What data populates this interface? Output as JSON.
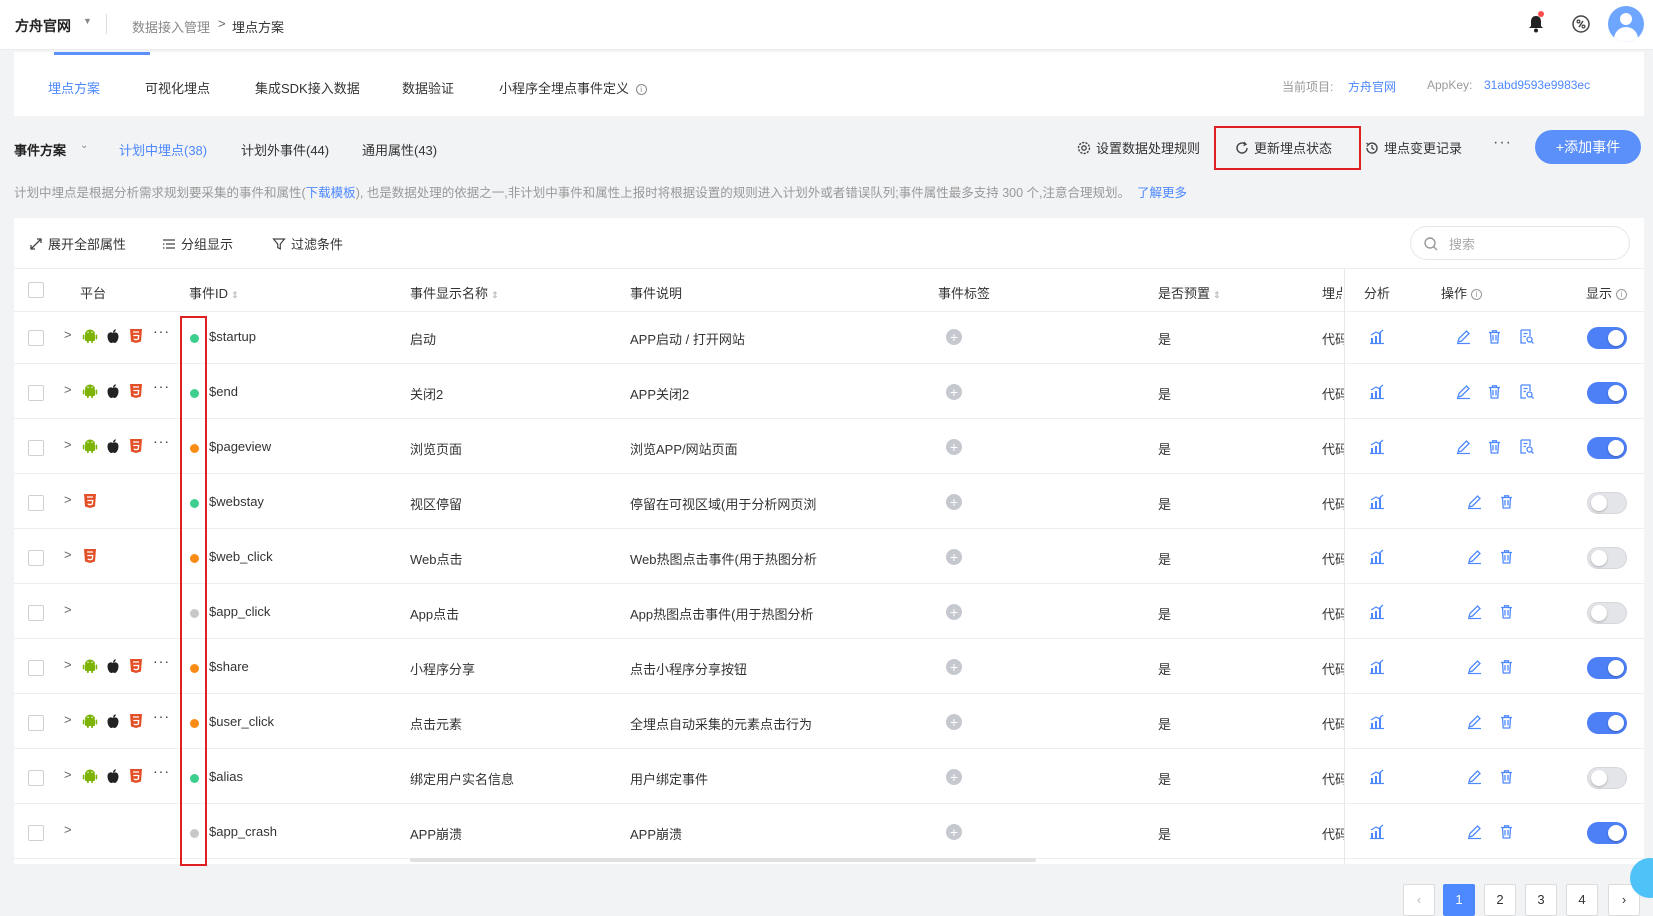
{
  "header": {
    "app_name": "方舟官网",
    "breadcrumb": [
      "数据接入管理",
      "埋点方案"
    ]
  },
  "subnav": {
    "tabs": [
      "埋点方案",
      "可视化埋点",
      "集成SDK接入数据",
      "数据验证",
      "小程序全埋点事件定义"
    ],
    "active": "埋点方案",
    "project_label": "当前项目:",
    "project_value": "方舟官网",
    "appkey_label": "AppKey:",
    "appkey_value": "31abd9593e9983ec"
  },
  "toolbar": {
    "scheme_label": "事件方案",
    "tabs": [
      "计划中埋点(38)",
      "计划外事件(44)",
      "通用属性(43)"
    ],
    "active_tab": "计划中埋点(38)",
    "actions": [
      "设置数据处理规则",
      "更新埋点状态",
      "埋点变更记录"
    ],
    "more": "···",
    "add_label": "+添加事件"
  },
  "notice": {
    "text_1": "计划中埋点是根据分析需求规划要采集的事件和属性(",
    "link_1": "下载模板",
    "text_2": "), 也是数据处理的依据之一,非计划中事件和属性上报时将根据设置的规则进入计划外或者错误队列;事件属性最多支持 300 个,注意合理规划。",
    "link_2": "了解更多"
  },
  "table_tools": {
    "expand_all": "展开全部属性",
    "group_show": "分组显示",
    "filter": "过滤条件",
    "search_placeholder": "搜索"
  },
  "columns": [
    "平台",
    "事件ID",
    "事件显示名称",
    "事件说明",
    "事件标签",
    "是否预置",
    "埋点",
    "分析",
    "操作",
    "显示"
  ],
  "rows": [
    {
      "platforms": [
        "android",
        "apple",
        "html5",
        "more"
      ],
      "status": "green",
      "id": "$startup",
      "name": "启动",
      "desc": "APP启动 / 打开网站",
      "preset": "是",
      "track": "代码",
      "ops": 3,
      "shown": true
    },
    {
      "platforms": [
        "android",
        "apple",
        "html5",
        "more"
      ],
      "status": "green",
      "id": "$end",
      "name": "关闭2",
      "desc": "APP关闭2",
      "preset": "是",
      "track": "代码",
      "ops": 3,
      "shown": true
    },
    {
      "platforms": [
        "android",
        "apple",
        "html5",
        "more"
      ],
      "status": "orange",
      "id": "$pageview",
      "name": "浏览页面",
      "desc": "浏览APP/网站页面",
      "preset": "是",
      "track": "代码",
      "ops": 3,
      "shown": true
    },
    {
      "platforms": [
        "html5"
      ],
      "status": "green",
      "id": "$webstay",
      "name": "视区停留",
      "desc": "停留在可视区域(用于分析网页浏",
      "preset": "是",
      "track": "代码",
      "ops": 2,
      "shown": false
    },
    {
      "platforms": [
        "html5"
      ],
      "status": "orange",
      "id": "$web_click",
      "name": "Web点击",
      "desc": "Web热图点击事件(用于热图分析",
      "preset": "是",
      "track": "代码",
      "ops": 2,
      "shown": false
    },
    {
      "platforms": [],
      "status": "gray",
      "id": "$app_click",
      "name": "App点击",
      "desc": "App热图点击事件(用于热图分析",
      "preset": "是",
      "track": "代码",
      "ops": 2,
      "shown": false
    },
    {
      "platforms": [
        "android",
        "apple",
        "html5",
        "more"
      ],
      "status": "orange",
      "id": "$share",
      "name": "小程序分享",
      "desc": "点击小程序分享按钮",
      "preset": "是",
      "track": "代码",
      "ops": 2,
      "shown": true
    },
    {
      "platforms": [
        "android",
        "apple",
        "html5",
        "more"
      ],
      "status": "orange",
      "id": "$user_click",
      "name": "点击元素",
      "desc": "全埋点自动采集的元素点击行为",
      "preset": "是",
      "track": "代码",
      "ops": 2,
      "shown": true
    },
    {
      "platforms": [
        "android",
        "apple",
        "html5",
        "more"
      ],
      "status": "green",
      "id": "$alias",
      "name": "绑定用户实名信息",
      "desc": "用户绑定事件",
      "preset": "是",
      "track": "代码",
      "ops": 2,
      "shown": false
    },
    {
      "platforms": [],
      "status": "gray",
      "id": "$app_crash",
      "name": "APP崩溃",
      "desc": "APP崩溃",
      "preset": "是",
      "track": "代码",
      "ops": 2,
      "shown": true
    }
  ],
  "colors": {
    "accent": "#4d88ff",
    "status_green": "#3ecf8e",
    "status_orange": "#fa8c16",
    "status_gray": "#c8c8c8",
    "android": "#7cb305",
    "apple": "#222222",
    "html5": "#e34f26",
    "highlight": "#e02020"
  },
  "pagination": {
    "pages": [
      "1",
      "2",
      "3",
      "4"
    ],
    "current": "1"
  }
}
